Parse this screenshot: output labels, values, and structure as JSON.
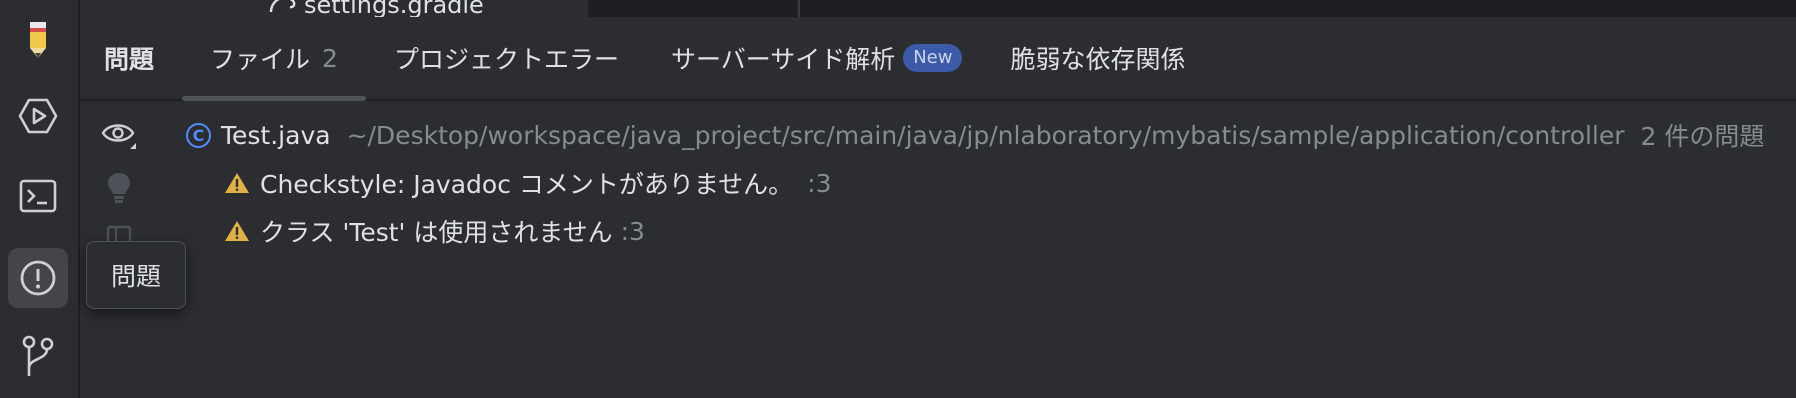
{
  "topband": {
    "tree_item": "settings.gradle"
  },
  "tabs": [
    {
      "label": "問題",
      "selected": false
    },
    {
      "label": "ファイル",
      "count": "2",
      "selected": true
    },
    {
      "label": "プロジェクトエラー",
      "selected": false
    },
    {
      "label": "サーバーサイド解析",
      "badge": "New",
      "selected": false
    },
    {
      "label": "脆弱な依存関係",
      "selected": false
    }
  ],
  "file": {
    "name": "Test.java",
    "path": "~/Desktop/workspace/java_project/src/main/java/jp/nlaboratory/mybatis/sample/application/controller",
    "problem_count": "2 件の問題"
  },
  "problems": [
    {
      "message": "Checkstyle: Javadoc コメントがありません。",
      "line": ":3"
    },
    {
      "message": "クラス 'Test' は使用されません",
      "line": ":3"
    }
  ],
  "tooltip": {
    "text": "問題"
  },
  "colors": {
    "accent": "#548af7",
    "warning": "#e0b341",
    "badge_bg": "#3d5aa8"
  }
}
